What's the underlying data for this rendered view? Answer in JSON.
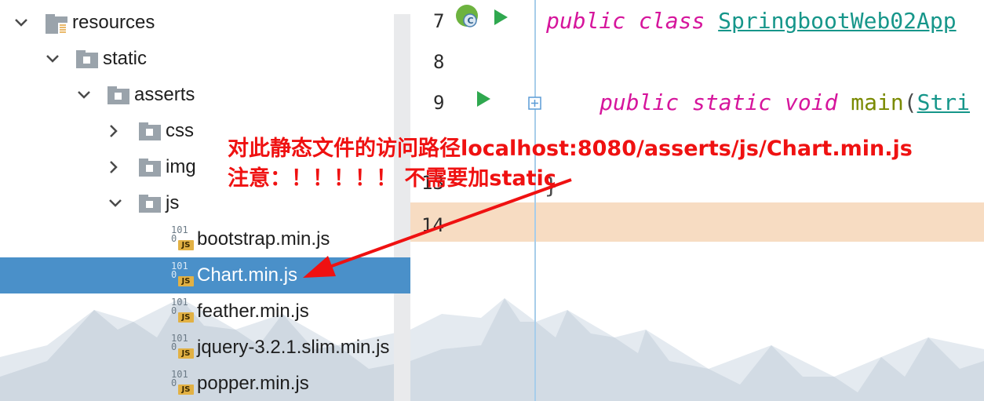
{
  "tree": {
    "items": [
      {
        "label": "resources",
        "type": "folder-res",
        "expanded": true
      },
      {
        "label": "static",
        "type": "folder",
        "expanded": true
      },
      {
        "label": "asserts",
        "type": "folder",
        "expanded": true
      },
      {
        "label": "css",
        "type": "folder",
        "expanded": false
      },
      {
        "label": "img",
        "type": "folder",
        "expanded": false
      },
      {
        "label": "js",
        "type": "folder",
        "expanded": true
      },
      {
        "label": "bootstrap.min.js",
        "type": "js-file"
      },
      {
        "label": "Chart.min.js",
        "type": "js-file",
        "selected": true
      },
      {
        "label": "feather.min.js",
        "type": "js-file"
      },
      {
        "label": "jquery-3.2.1.slim.min.js",
        "type": "js-file"
      },
      {
        "label": "popper.min.js",
        "type": "js-file"
      }
    ],
    "js_icon_bits": "101\n0",
    "js_icon_badge": "JS"
  },
  "editor": {
    "lines": [
      {
        "number": "7",
        "tokens": [
          {
            "t": "public class ",
            "k": "kw"
          },
          {
            "t": "SpringbootWeb02App",
            "k": "cls"
          }
        ]
      },
      {
        "number": "8",
        "tokens": []
      },
      {
        "number": "9",
        "tokens": [
          {
            "t": "public static void ",
            "k": "kw"
          },
          {
            "t": "main",
            "k": "fn"
          },
          {
            "t": "(",
            "k": "plain"
          },
          {
            "t": "Stri",
            "k": "cls"
          }
        ]
      },
      {
        "number": "13",
        "tokens": [
          {
            "t": "}",
            "k": "plain"
          }
        ]
      },
      {
        "number": "14",
        "tokens": []
      }
    ],
    "gutter_icons": [
      "spring-boot-run-icon",
      "run-icon"
    ]
  },
  "annotation": {
    "line1": "对此静态文件的访问路径localhost:8080/asserts/js/Chart.min.js",
    "line2": "注意：！！！！！ 不需要加static",
    "color": "#ef1111"
  },
  "colors": {
    "selection": "#4a90c9",
    "keyword": "#d6159c",
    "class_name": "#16968a",
    "method": "#7a8a00",
    "highlight_line": "#f7dcc2"
  }
}
